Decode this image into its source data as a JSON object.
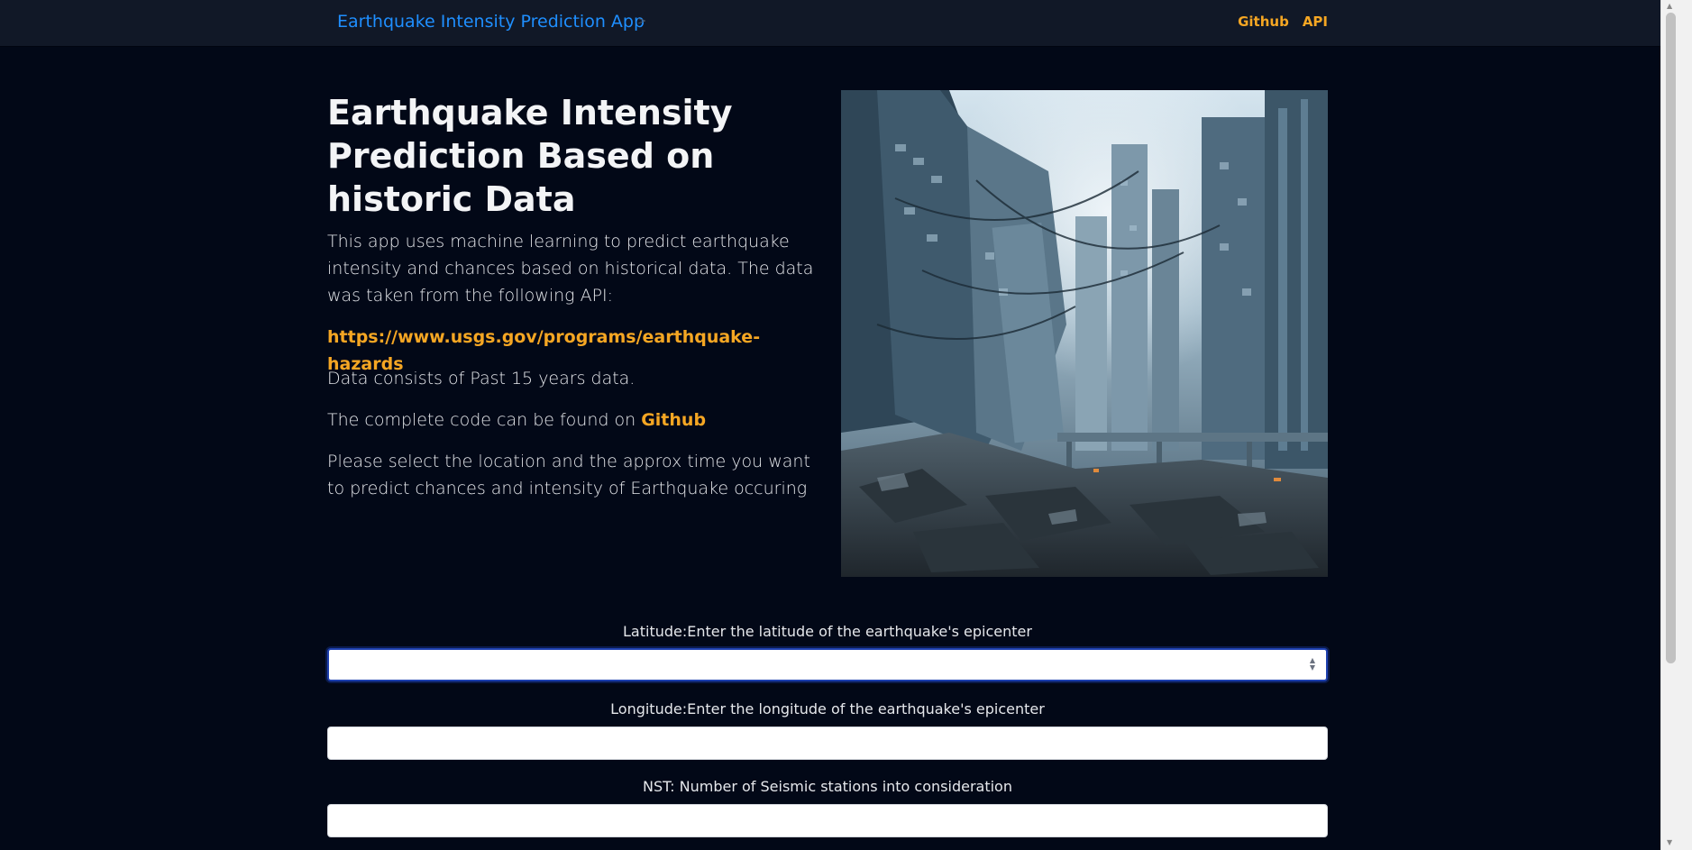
{
  "navbar": {
    "brand": "Earthquake Intensity Prediction App",
    "brand_separator": ">",
    "links": [
      {
        "label": "Github"
      },
      {
        "label": "API"
      }
    ]
  },
  "hero": {
    "title": "Earthquake Intensity Prediction Based on historic Data",
    "intro": "This app uses machine learning to predict earthquake intensity and chances based on historical data. The data was taken from the following API:",
    "api_url": "https://www.usgs.gov/programs/earthquake-hazards",
    "data_note": "Data consists of Past 15 years data.",
    "code_prefix": "The complete code can be found on ",
    "code_link": "Github",
    "instruction": "Please select the location and the approx time you want to predict chances and intensity of Earthquake occuring"
  },
  "form": {
    "fields": [
      {
        "label": "Latitude:Enter the latitude of the earthquake's epicenter",
        "value": ""
      },
      {
        "label": "Longitude:Enter the longitude of the earthquake's epicenter",
        "value": ""
      },
      {
        "label": "NST: Number of Seismic stations into consideration",
        "value": ""
      }
    ]
  },
  "colors": {
    "background": "#020817",
    "navbar": "#111827",
    "brand": "#1f8fff",
    "accent": "#f5a623",
    "focus_border": "#1e40af"
  },
  "icons": {
    "number_spinner": "spinner-arrows-icon"
  }
}
